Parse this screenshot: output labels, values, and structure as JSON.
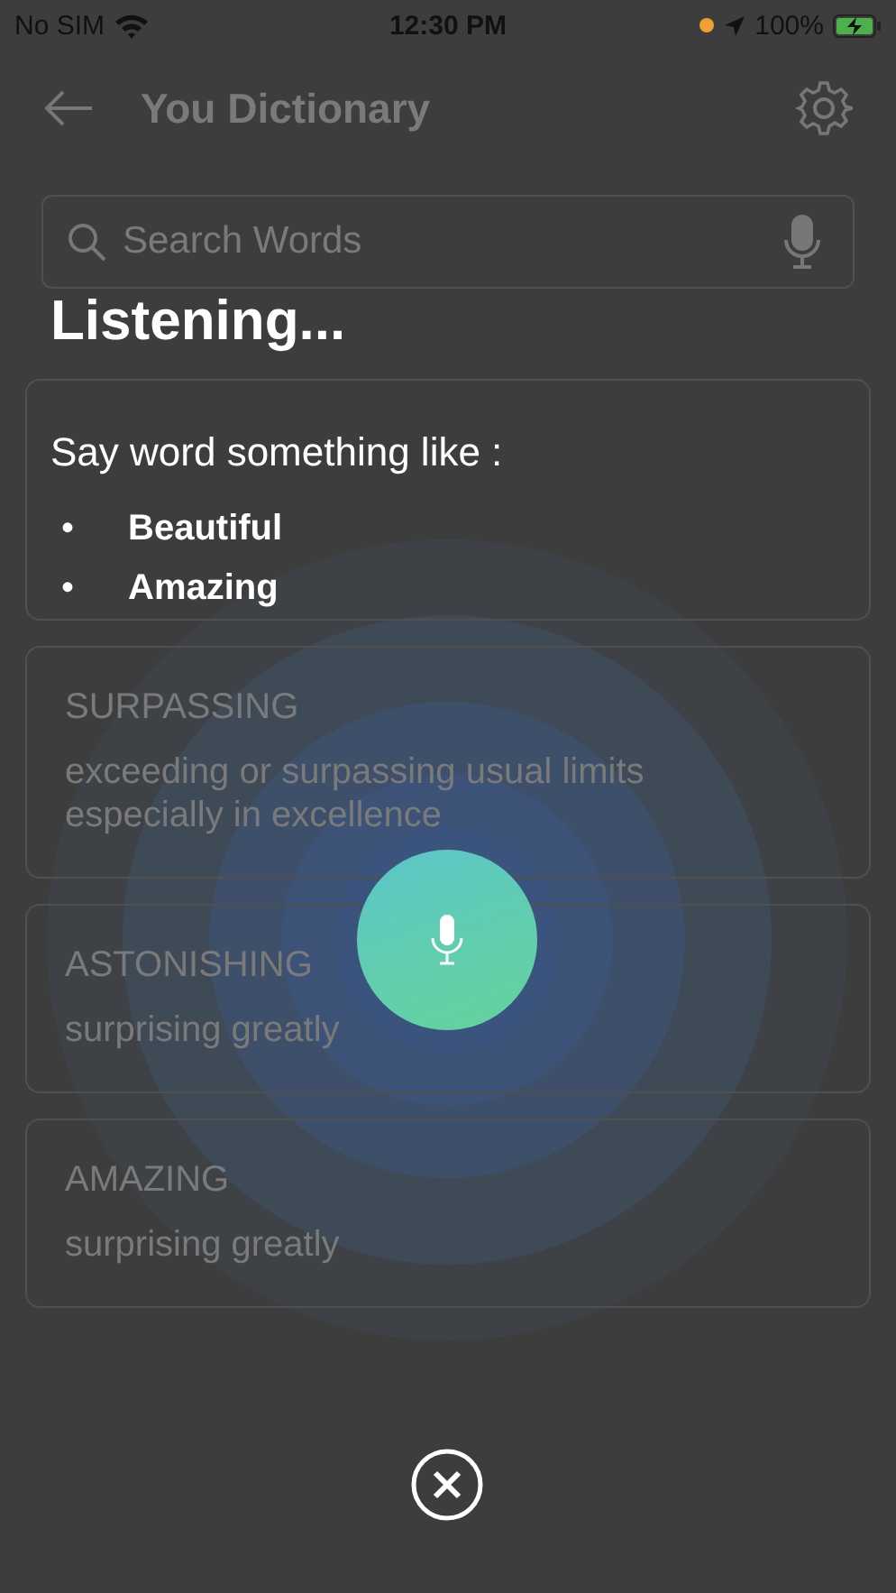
{
  "status_bar": {
    "carrier": "No SIM",
    "time": "12:30 PM",
    "battery": "100%"
  },
  "header": {
    "title": "You Dictionary"
  },
  "search": {
    "placeholder": "Search Words"
  },
  "cards": [
    {
      "word": "SURPASSING",
      "definition": "exceeding or surpassing usual limits especially in excellence"
    },
    {
      "word": "ASTONISHING",
      "definition": "surprising greatly"
    },
    {
      "word": "AMAZING",
      "definition": "surprising greatly"
    }
  ],
  "listening": {
    "title": "Listening...",
    "prompt": "Say word something like :",
    "examples": [
      {
        "bullet": "•",
        "word": "Beautiful"
      },
      {
        "bullet": "•",
        "word": "Amazing"
      }
    ]
  }
}
